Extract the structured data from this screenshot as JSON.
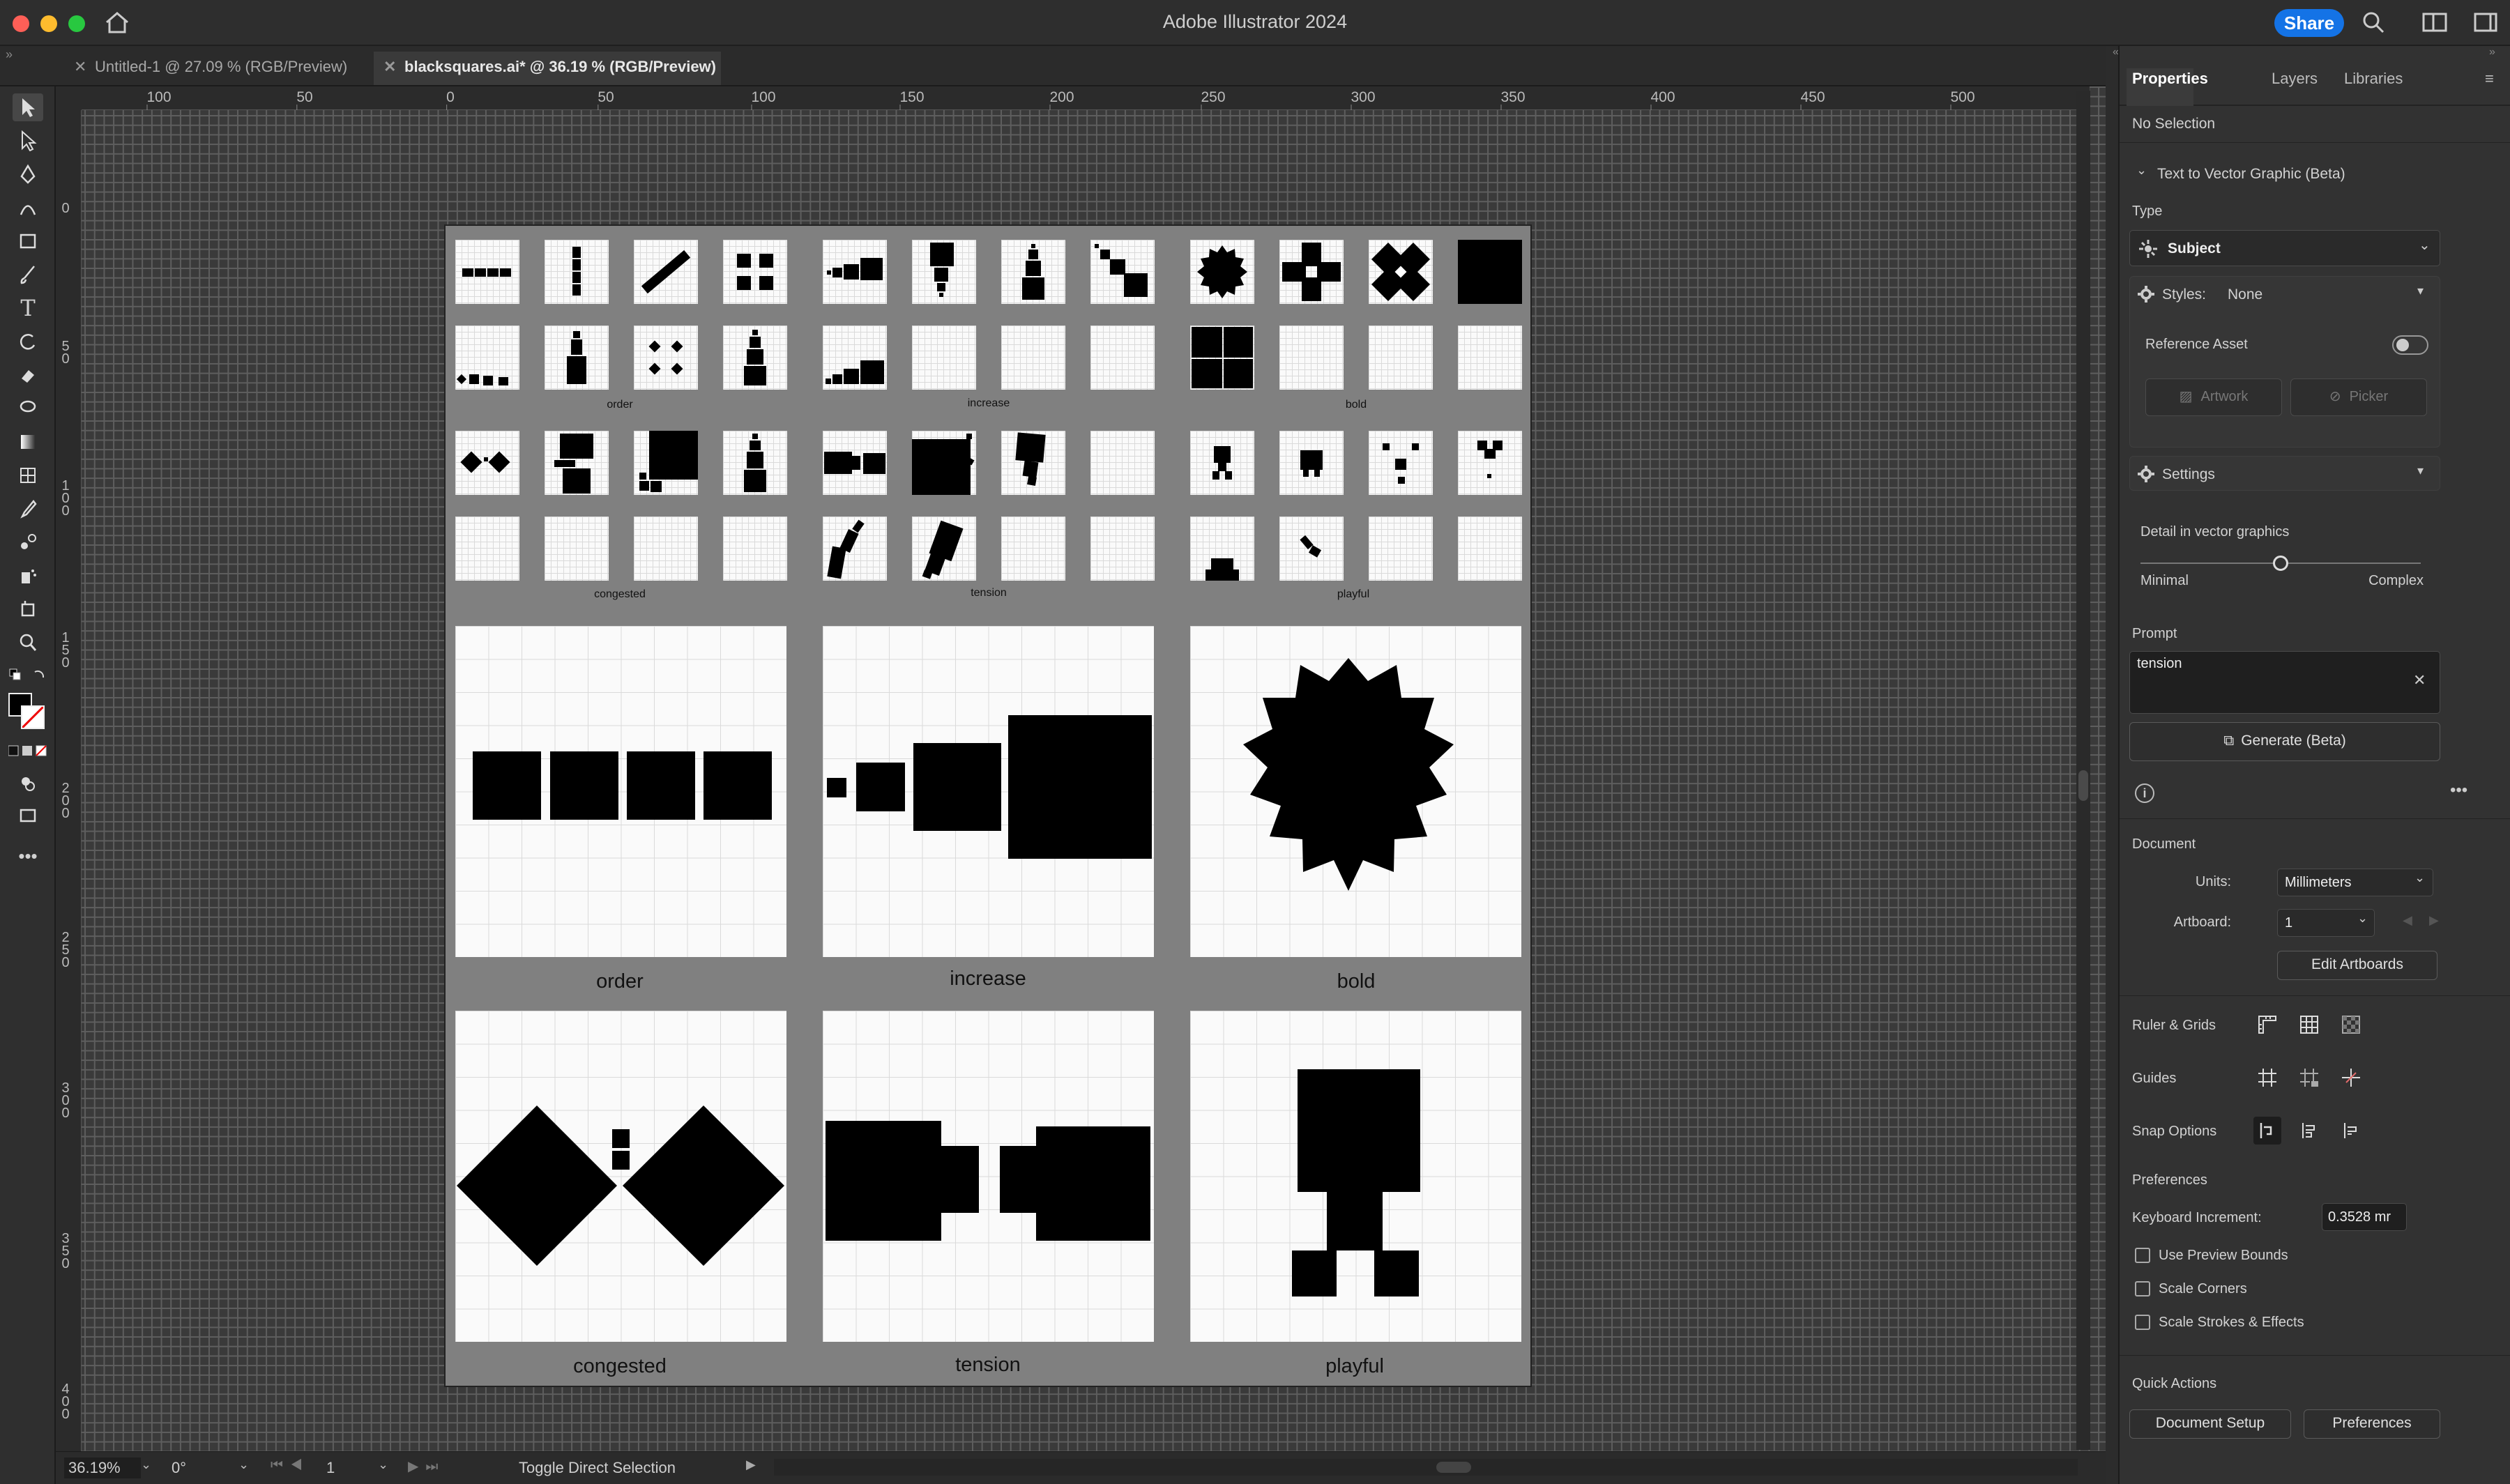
{
  "app": {
    "title": "Adobe Illustrator 2024",
    "share_label": "Share"
  },
  "tabs": [
    {
      "label": "Untitled-1 @ 27.09 % (RGB/Preview)"
    },
    {
      "label": "blacksquares.ai* @ 36.19 % (RGB/Preview)"
    }
  ],
  "ruler": {
    "top": [
      "100",
      "50",
      "0",
      "50",
      "100",
      "150",
      "200",
      "250",
      "300",
      "350",
      "400",
      "450",
      "500"
    ],
    "left": [
      "0",
      "50",
      "100",
      "150",
      "200",
      "250",
      "300",
      "350",
      "400"
    ]
  },
  "artboard": {
    "small_captions": [
      "order",
      "increase",
      "bold",
      "congested",
      "tension",
      "playful"
    ],
    "big_captions": [
      "order",
      "increase",
      "bold",
      "congested",
      "tension",
      "playful"
    ]
  },
  "status": {
    "zoom": "36.19%",
    "rotation": "0°",
    "artboard": "1",
    "tool_hint": "Toggle Direct Selection"
  },
  "panel": {
    "tabs": [
      "Properties",
      "Layers",
      "Libraries"
    ],
    "selection": "No Selection",
    "section_title": "Text to Vector Graphic (Beta)",
    "type_label": "Type",
    "type_value": "Subject",
    "styles_label": "Styles:",
    "styles_value": "None",
    "reference_asset": "Reference Asset",
    "artwork": "Artwork",
    "picker": "Picker",
    "settings": "Settings",
    "detail_label": "Detail in vector graphics",
    "detail_min": "Minimal",
    "detail_max": "Complex",
    "detail_level": 0.5,
    "prompt_label": "Prompt",
    "prompt_value": "tension",
    "generate": "Generate (Beta)",
    "document": "Document",
    "units_label": "Units:",
    "units_value": "Millimeters",
    "artboard_label": "Artboard:",
    "artboard_value": "1",
    "edit_artboards": "Edit Artboards",
    "ruler_grids": "Ruler & Grids",
    "guides": "Guides",
    "snap_options": "Snap Options",
    "preferences_title": "Preferences",
    "keyboard_increment_label": "Keyboard Increment:",
    "keyboard_increment_value": "0.3528 mr",
    "use_preview_bounds": "Use Preview Bounds",
    "scale_corners": "Scale Corners",
    "scale_strokes": "Scale Strokes & Effects",
    "quick_actions": "Quick Actions",
    "document_setup": "Document Setup",
    "preferences_btn": "Preferences"
  },
  "colors": {
    "accent": "#1473e6",
    "panel_bg": "#323232",
    "canvas_bg": "#3a3a3a"
  }
}
